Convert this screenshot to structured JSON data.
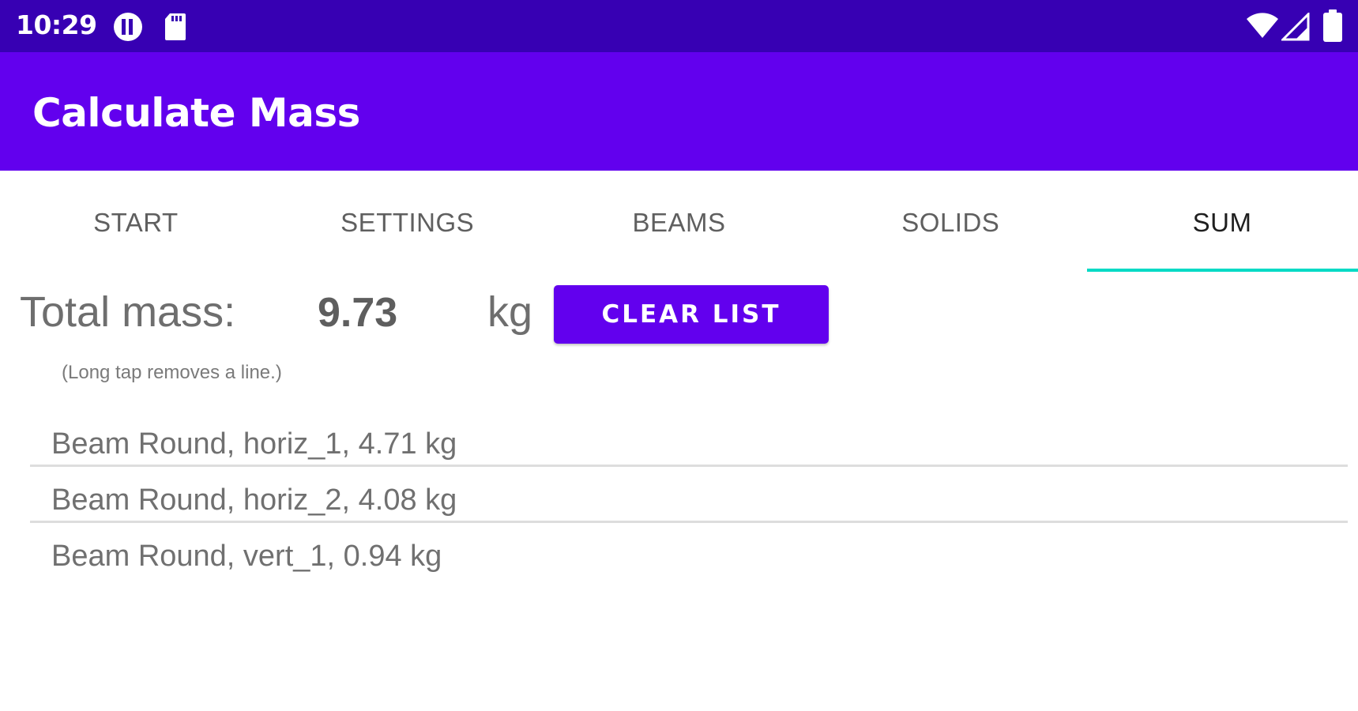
{
  "status_bar": {
    "time": "10:29",
    "icons_left": [
      "pause-circle-icon",
      "sd-card-icon"
    ],
    "icons_right": [
      "wifi-icon",
      "cell-signal-icon",
      "battery-icon"
    ]
  },
  "app_bar": {
    "title": "Calculate Mass",
    "color": "#6200ee"
  },
  "tabs": [
    {
      "label": "START",
      "active": false
    },
    {
      "label": "SETTINGS",
      "active": false
    },
    {
      "label": "BEAMS",
      "active": false
    },
    {
      "label": "SOLIDS",
      "active": false
    },
    {
      "label": "SUM",
      "active": true
    }
  ],
  "summary": {
    "label": "Total mass:",
    "value": "9.73",
    "unit": "kg",
    "clear_label": "CLEAR LIST",
    "hint": "(Long tap removes a line.)"
  },
  "items": [
    "Beam Round, horiz_1, 4.71 kg",
    "Beam Round, horiz_2, 4.08 kg",
    "Beam Round, vert_1, 0.94 kg"
  ],
  "colors": {
    "status_bar": "#3700b3",
    "primary": "#6200ee",
    "tab_indicator": "#03dac5"
  }
}
